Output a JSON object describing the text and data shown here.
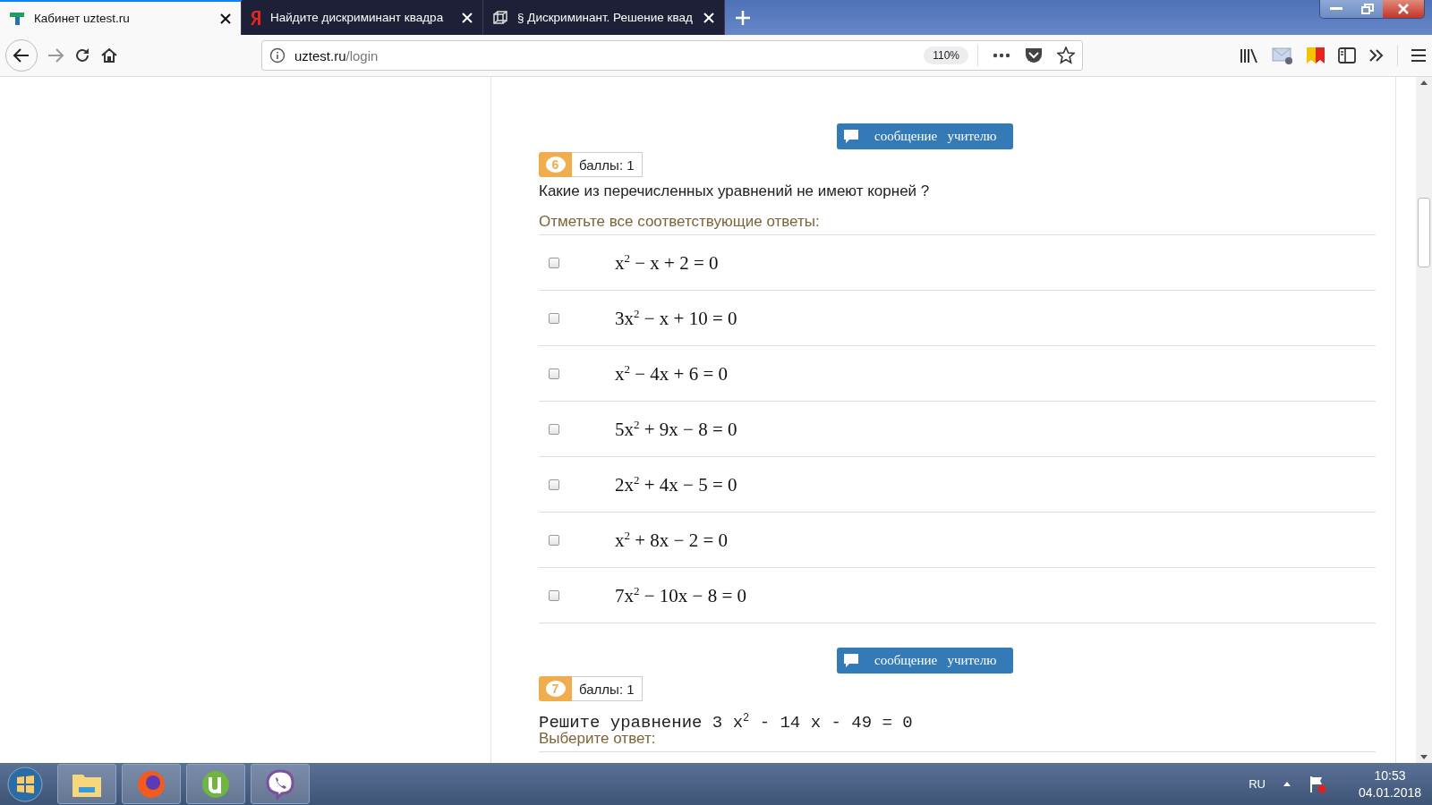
{
  "browser": {
    "tabs": [
      {
        "title": "Кабинет uztest.ru",
        "selected": true
      },
      {
        "title": "Найдите дискриминант квадра",
        "selected": false
      },
      {
        "title": "§ Дискриминант. Решение квад",
        "selected": false
      }
    ],
    "url": {
      "host": "uztest.ru",
      "path": "/login"
    },
    "zoom": "110%"
  },
  "questions": [
    {
      "number": "6",
      "score": "баллы: 1",
      "message_button": "сообщение   учителю",
      "kind": "plain",
      "text": "Какие из перечисленных уравнений не имеют корней ?",
      "prompt": "Отметьте все соответствующие ответы:",
      "options": [
        {
          "equation": "x$^{2}$ − x + 2 = 0",
          "checked": false
        },
        {
          "equation": "3x$^{2}$ − x + 10 = 0",
          "checked": false
        },
        {
          "equation": "x$^{2}$ − 4x + 6 = 0",
          "checked": false
        },
        {
          "equation": "5x$^{2}$ + 9x − 8 = 0",
          "checked": false
        },
        {
          "equation": "2x$^{2}$ + 4x − 5 = 0",
          "checked": false
        },
        {
          "equation": "x$^{2}$ + 8x − 2 = 0",
          "checked": false
        },
        {
          "equation": "7x$^{2}$ − 10x − 8 = 0",
          "checked": false
        }
      ]
    },
    {
      "number": "7",
      "score": "баллы: 1",
      "message_button": "сообщение   учителю",
      "kind": "mono",
      "text": "Решите уравнение 3 x$^{2}$ - 14 x - 49 = 0",
      "prompt": "Выберите ответ:"
    }
  ],
  "taskbar": {
    "language": "RU",
    "time": "10:53",
    "date": "04.01.2018"
  }
}
